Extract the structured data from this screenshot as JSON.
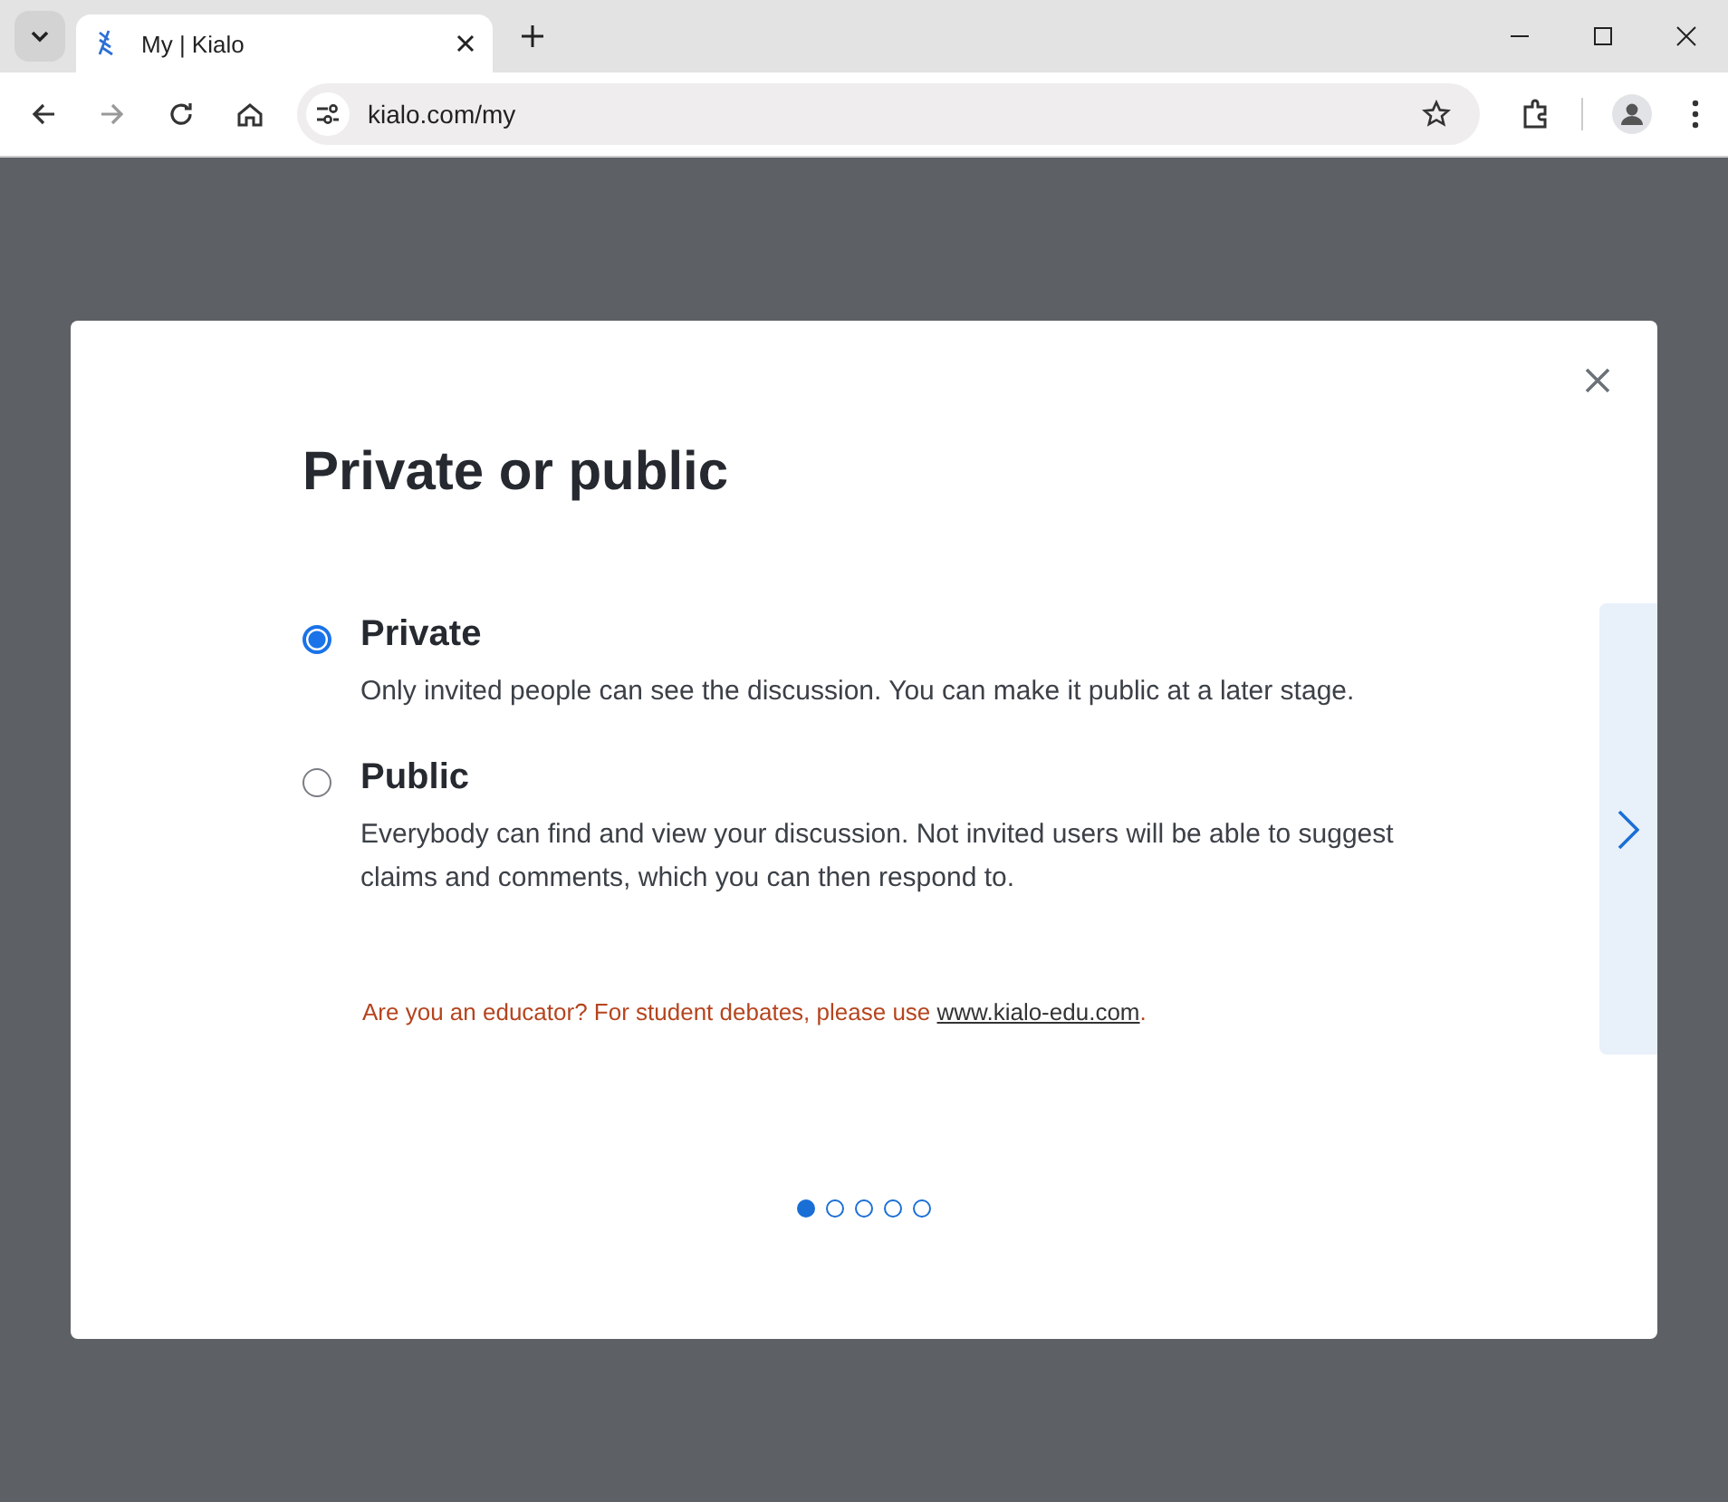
{
  "browser": {
    "tab": {
      "title": "My | Kialo"
    },
    "address": "kialo.com/my"
  },
  "modal": {
    "title": "Private or public",
    "options": [
      {
        "label": "Private",
        "description": "Only invited people can see the discussion. You can make it public at a later stage.",
        "selected": true
      },
      {
        "label": "Public",
        "description": "Everybody can find and view your discussion. Not invited users will be able to suggest claims and comments, which you can then respond to.",
        "selected": false
      }
    ],
    "note": {
      "text": "Are you an educator? For student debates, please use ",
      "link": "www.kialo-edu.com",
      "end": "."
    },
    "pages": [
      {
        "selected": true
      },
      {
        "selected": false
      },
      {
        "selected": false
      },
      {
        "selected": false
      },
      {
        "selected": false
      }
    ]
  }
}
